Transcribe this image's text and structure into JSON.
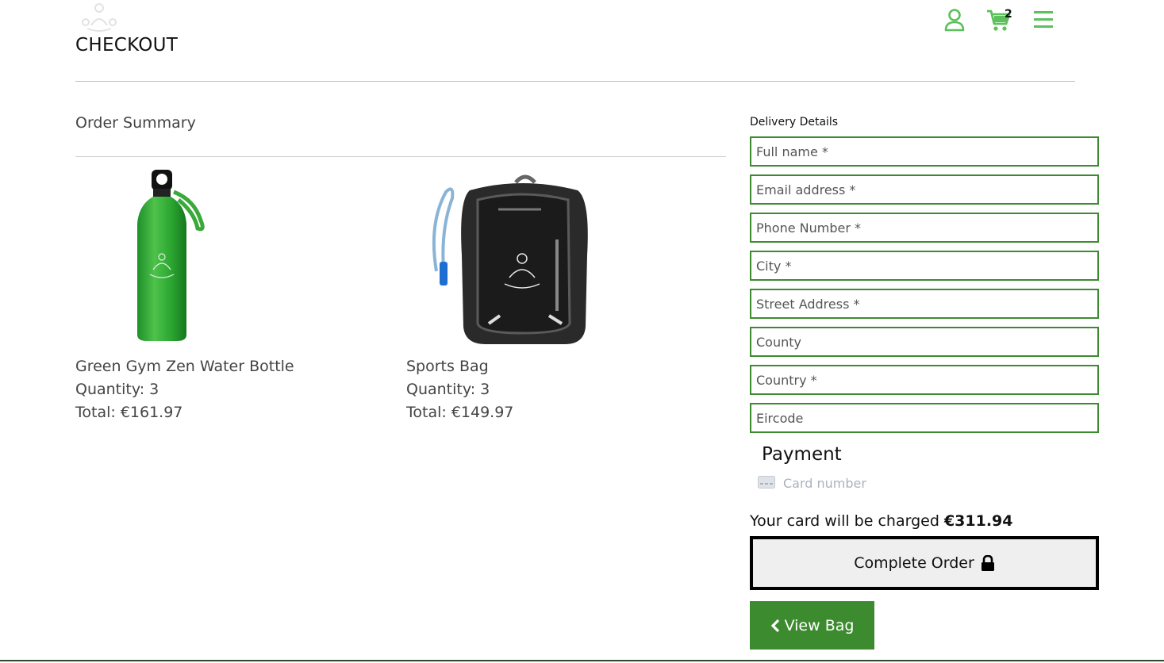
{
  "header": {
    "title": "CHECKOUT",
    "cart_count": "2",
    "accent_color": "#5cc05c"
  },
  "summary": {
    "title": "Order Summary",
    "items": [
      {
        "name": "Green Gym Zen Water Bottle",
        "quantity": "Quantity: 3",
        "total": "Total: €161.97",
        "image": "green-water-bottle"
      },
      {
        "name": "Sports Bag",
        "quantity": "Quantity: 3",
        "total": "Total: €149.97",
        "image": "black-sports-backpack"
      }
    ]
  },
  "delivery": {
    "label": "Delivery Details",
    "fields": [
      {
        "name": "full-name",
        "placeholder": "Full name *"
      },
      {
        "name": "email",
        "placeholder": "Email address *"
      },
      {
        "name": "phone",
        "placeholder": "Phone Number *"
      },
      {
        "name": "city",
        "placeholder": "City *"
      },
      {
        "name": "street-address",
        "placeholder": "Street Address *"
      },
      {
        "name": "county",
        "placeholder": "County"
      },
      {
        "name": "country",
        "placeholder": "Country *"
      },
      {
        "name": "eircode",
        "placeholder": "Eircode"
      }
    ],
    "border_color": "#3d8b2f"
  },
  "payment": {
    "title": "Payment",
    "card_placeholder": "Card number",
    "charge_text": "Your card will be charged",
    "charge_amount": "€311.94"
  },
  "actions": {
    "complete_label": "Complete Order",
    "view_bag_label": "View Bag",
    "view_bag_color": "#3d8b2f"
  }
}
